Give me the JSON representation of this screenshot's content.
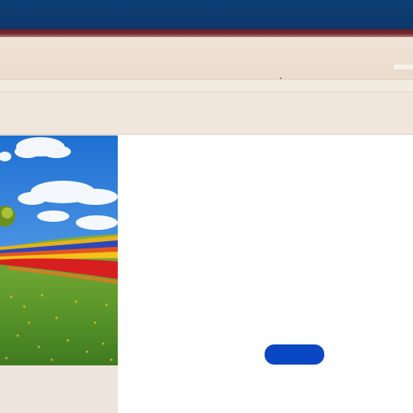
{
  "window": {
    "title_bar_color": "#0e3f76",
    "accent_color": "#6b2430"
  },
  "main": {
    "hero_image": "landscape-photo",
    "cta_button": {
      "label": "",
      "color": "#0a47c2"
    }
  }
}
